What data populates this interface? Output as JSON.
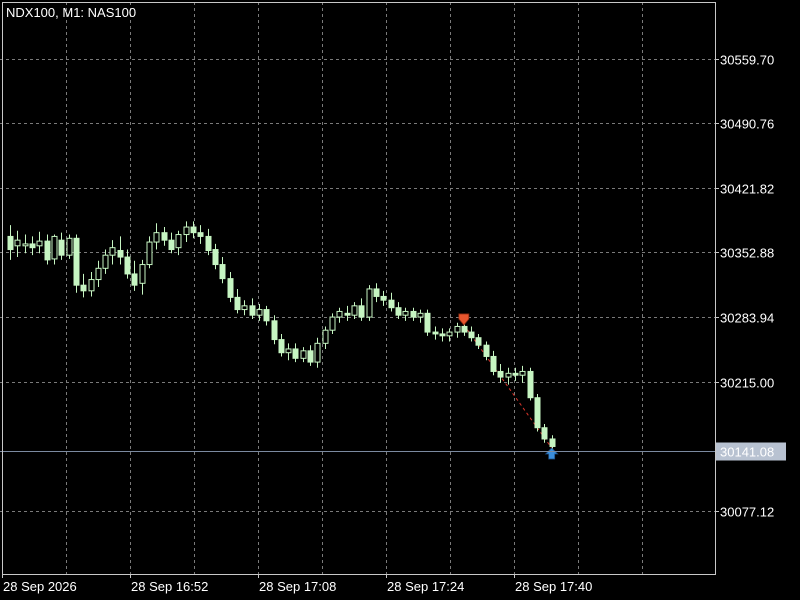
{
  "header": {
    "title": "NDX100, M1:  NAS100"
  },
  "colors": {
    "background": "#000000",
    "grid": "#7a7a7a",
    "frame": "#c8c8c8",
    "candle_up": "#c6f5c2",
    "candle_down": "#c6f5c2",
    "wick": "#c6f5c2",
    "bid_line": "#7b8aa0",
    "price_tag_bg": "#b8c2d1",
    "price_tag_text": "#ffffff",
    "sell_arrow": "#e8562e",
    "buy_arrow": "#3b8fdc",
    "trade_line": "#d8352a"
  },
  "chart_data": {
    "type": "candlestick",
    "symbol": "NDX100",
    "timeframe": "M1",
    "description": "NAS100",
    "grid": true,
    "y_axis_ticks": [
      "30559.70",
      "30490.76",
      "30421.82",
      "30352.88",
      "30283.94",
      "30215.00",
      "30077.12"
    ],
    "x_axis_ticks": [
      "28 Sep 2026",
      "28 Sep 16:52",
      "28 Sep 17:08",
      "28 Sep 17:24",
      "28 Sep 17:40"
    ],
    "current_price": "30141.08",
    "ylim": [
      30010,
      30620
    ],
    "candles": [
      [
        30370,
        30382,
        30345,
        30356
      ],
      [
        30360,
        30376,
        30348,
        30366
      ],
      [
        30360,
        30372,
        30352,
        30362
      ],
      [
        30362,
        30370,
        30350,
        30358
      ],
      [
        30360,
        30375,
        30352,
        30365
      ],
      [
        30365,
        30372,
        30340,
        30345
      ],
      [
        30346,
        30372,
        30340,
        30370
      ],
      [
        30366,
        30374,
        30345,
        30350
      ],
      [
        30350,
        30372,
        30346,
        30368
      ],
      [
        30368,
        30372,
        30310,
        30318
      ],
      [
        30318,
        30330,
        30305,
        30312
      ],
      [
        30312,
        30332,
        30306,
        30324
      ],
      [
        30324,
        30344,
        30316,
        30336
      ],
      [
        30336,
        30356,
        30330,
        30350
      ],
      [
        30350,
        30366,
        30340,
        30358
      ],
      [
        30355,
        30370,
        30340,
        30348
      ],
      [
        30348,
        30356,
        30325,
        30330
      ],
      [
        30330,
        30344,
        30312,
        30318
      ],
      [
        30320,
        30345,
        30308,
        30340
      ],
      [
        30340,
        30370,
        30336,
        30364
      ],
      [
        30364,
        30384,
        30356,
        30374
      ],
      [
        30374,
        30380,
        30360,
        30366
      ],
      [
        30366,
        30374,
        30352,
        30356
      ],
      [
        30358,
        30376,
        30350,
        30372
      ],
      [
        30372,
        30386,
        30364,
        30380
      ],
      [
        30380,
        30386,
        30368,
        30374
      ],
      [
        30374,
        30382,
        30362,
        30370
      ],
      [
        30370,
        30378,
        30350,
        30355
      ],
      [
        30356,
        30362,
        30335,
        30340
      ],
      [
        30340,
        30348,
        30320,
        30325
      ],
      [
        30325,
        30332,
        30300,
        30305
      ],
      [
        30305,
        30314,
        30288,
        30292
      ],
      [
        30292,
        30302,
        30286,
        30296
      ],
      [
        30296,
        30304,
        30282,
        30286
      ],
      [
        30286,
        30298,
        30280,
        30292
      ],
      [
        30292,
        30296,
        30275,
        30280
      ],
      [
        30280,
        30286,
        30255,
        30260
      ],
      [
        30260,
        30266,
        30242,
        30246
      ],
      [
        30246,
        30256,
        30238,
        30250
      ],
      [
        30250,
        30256,
        30236,
        30240
      ],
      [
        30240,
        30252,
        30236,
        30248
      ],
      [
        30248,
        30254,
        30232,
        30236
      ],
      [
        30236,
        30262,
        30230,
        30256
      ],
      [
        30256,
        30274,
        30250,
        30270
      ],
      [
        30270,
        30288,
        30266,
        30284
      ],
      [
        30284,
        30294,
        30278,
        30290
      ],
      [
        30288,
        30296,
        30280,
        30286
      ],
      [
        30286,
        30300,
        30282,
        30296
      ],
      [
        30296,
        30304,
        30280,
        30284
      ],
      [
        30284,
        30318,
        30280,
        30314
      ],
      [
        30314,
        30320,
        30300,
        30306
      ],
      [
        30306,
        30312,
        30296,
        30302
      ],
      [
        30302,
        30310,
        30290,
        30294
      ],
      [
        30294,
        30300,
        30282,
        30286
      ],
      [
        30286,
        30294,
        30280,
        30290
      ],
      [
        30290,
        30294,
        30280,
        30284
      ],
      [
        30284,
        30292,
        30278,
        30288
      ],
      [
        30288,
        30292,
        30264,
        30268
      ],
      [
        30268,
        30274,
        30260,
        30266
      ],
      [
        30266,
        30272,
        30258,
        30264
      ],
      [
        30264,
        30272,
        30258,
        30268
      ],
      [
        30268,
        30278,
        30262,
        30274
      ],
      [
        30274,
        30280,
        30264,
        30268
      ],
      [
        30268,
        30274,
        30258,
        30262
      ],
      [
        30262,
        30266,
        30250,
        30254
      ],
      [
        30254,
        30258,
        30238,
        30242
      ],
      [
        30242,
        30248,
        30222,
        30226
      ],
      [
        30226,
        30234,
        30214,
        30220
      ],
      [
        30220,
        30230,
        30212,
        30224
      ],
      [
        30224,
        30230,
        30216,
        30222
      ],
      [
        30222,
        30232,
        30214,
        30226
      ],
      [
        30226,
        30230,
        30195,
        30198
      ],
      [
        30198,
        30202,
        30162,
        30166
      ],
      [
        30166,
        30170,
        30150,
        30154
      ],
      [
        30154,
        30158,
        30140,
        30146
      ]
    ],
    "trades": [
      {
        "type": "sell",
        "candle_index": 62,
        "price": 30282
      },
      {
        "type": "buy",
        "candle_index": 74,
        "price": 30138
      }
    ]
  }
}
